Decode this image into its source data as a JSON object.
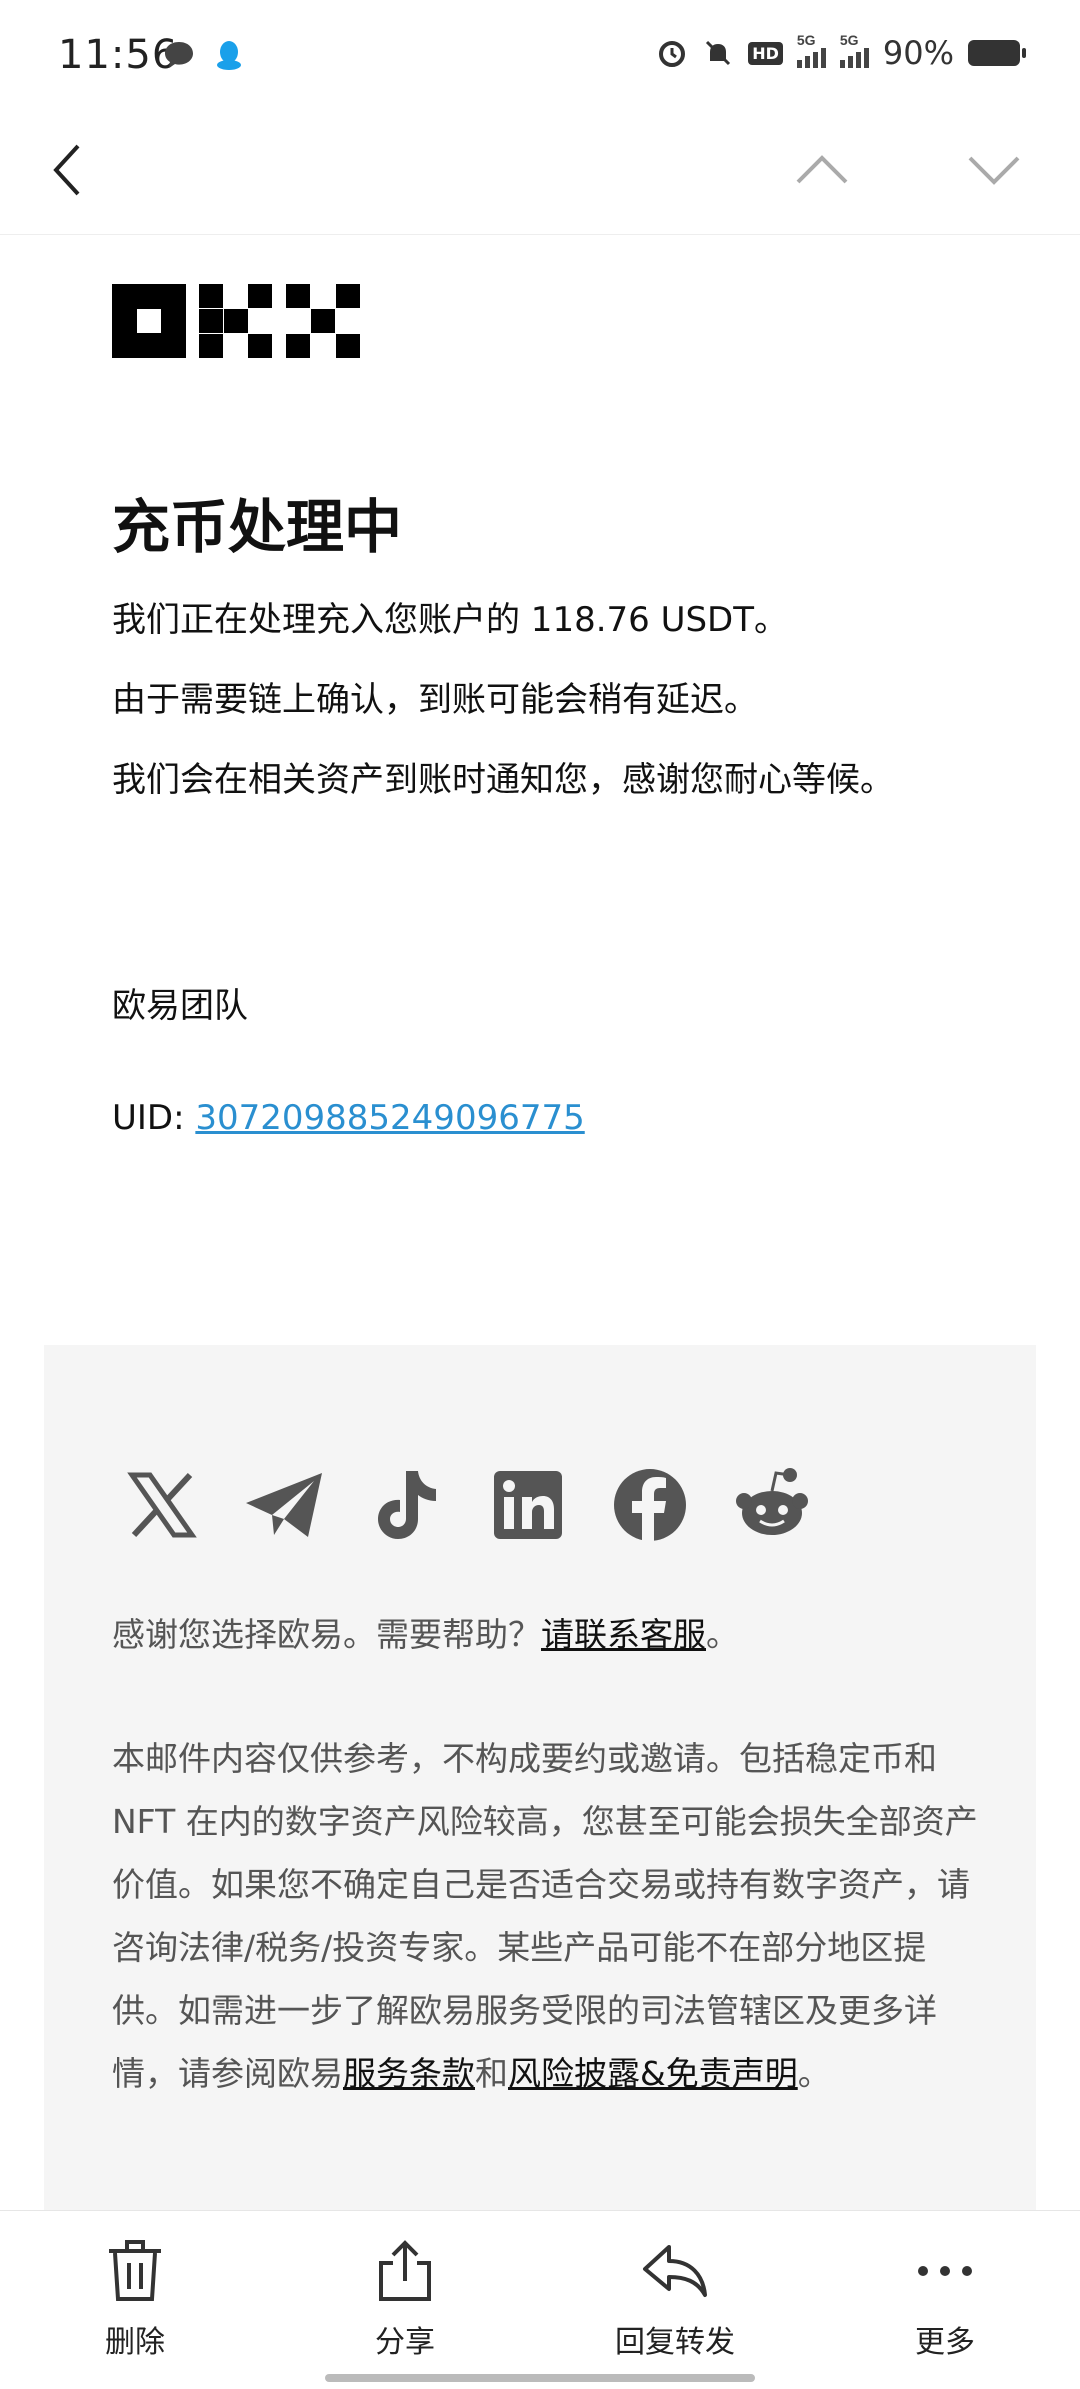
{
  "status": {
    "time": "11:56",
    "battery": "90%"
  },
  "email": {
    "title": "充币处理中",
    "line1": "我们正在处理充入您账户的 118.76 USDT。",
    "line2": "由于需要链上确认，到账可能会稍有延迟。",
    "line3": "我们会在相关资产到账时通知您，感谢您耐心等候。",
    "signature": "欧易团队",
    "uid_label": "UID: ",
    "uid_value": "307209885249096775"
  },
  "footer": {
    "help_prefix": "感谢您选择欧易。需要帮助？",
    "help_link": "请联系客服",
    "help_suffix": "。",
    "disclaimer": "本邮件内容仅供参考，不构成要约或邀请。包括稳定币和 NFT 在内的数字资产风险较高，您甚至可能会损失全部资产价值。如果您不确定自己是否适合交易或持有数字资产，请咨询法律/税务/投资专家。某些产品可能不在部分地区提供。如需进一步了解欧易服务受限的司法管辖区及更多详情，请参阅欧易",
    "terms_link": "服务条款",
    "and": "和",
    "risk_link": "风险披露&免责声明",
    "end": "。"
  },
  "toolbar": {
    "delete": "删除",
    "share": "分享",
    "reply_forward": "回复转发",
    "more": "更多"
  }
}
